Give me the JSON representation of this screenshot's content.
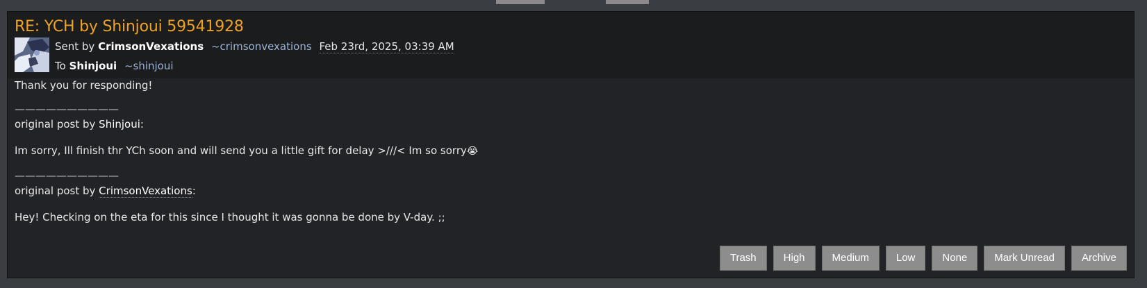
{
  "message": {
    "title": "RE: YCH by Shinjoui 59541928",
    "sent_prefix": "Sent by",
    "sender_name": "CrimsonVexations",
    "sender_handle": "~crimsonvexations",
    "date": "Feb 23rd, 2025, 03:39 AM",
    "to_prefix": "To",
    "recipient_name": "Shinjoui",
    "recipient_handle": "~shinjoui"
  },
  "body": {
    "line1": "Thank you for responding!",
    "divider1": "——————————",
    "quote1_prefix": "original post by ",
    "quote1_user": "Shinjoui",
    "quote1_suffix": ":",
    "quote1_text": "Im sorry, Ill finish thr YCh soon and will send you a little gift for delay >///< Im so sorry",
    "quote1_emoji": "😭",
    "divider2": "——————————",
    "quote2_prefix": "original post by ",
    "quote2_user": "CrimsonVexations",
    "quote2_suffix": ":",
    "quote2_text": "Hey! Checking on the eta for this since I thought it was gonna be done by V-day. ;;"
  },
  "actions": {
    "trash": "Trash",
    "high": "High",
    "medium": "Medium",
    "low": "Low",
    "none": "None",
    "mark_unread": "Mark Unread",
    "archive": "Archive"
  }
}
